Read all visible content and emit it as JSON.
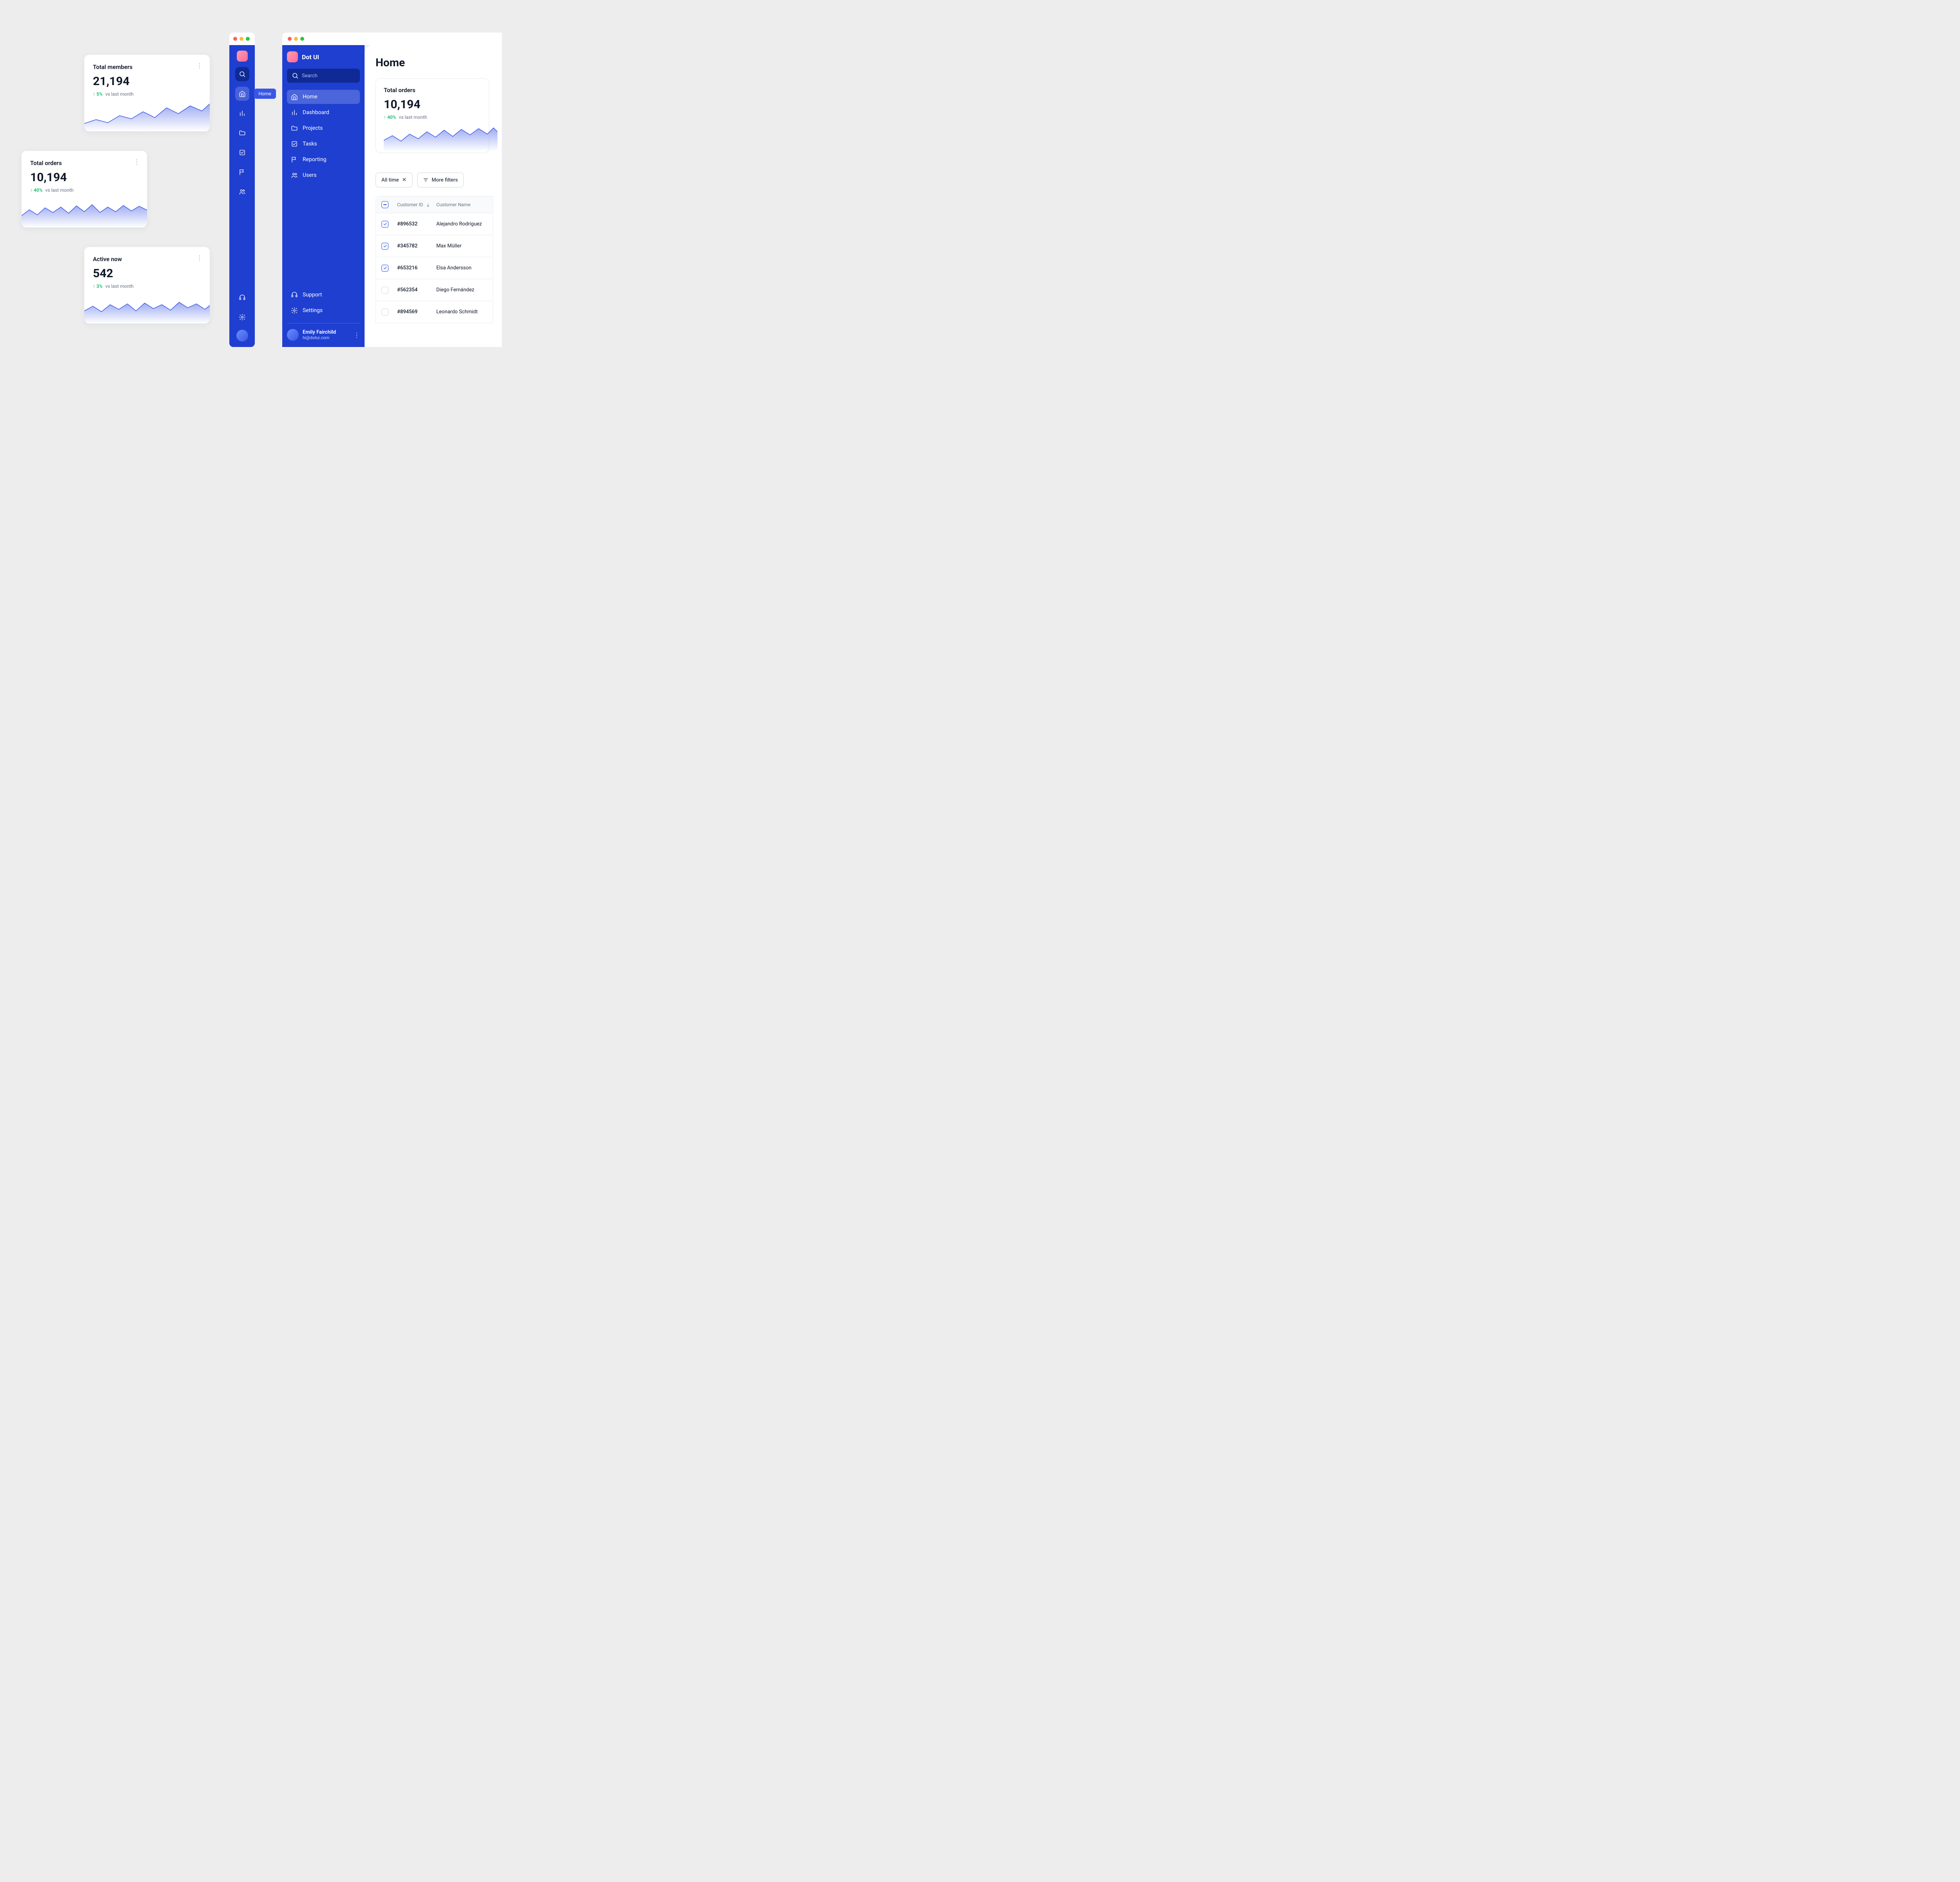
{
  "cards": {
    "members": {
      "title": "Total members",
      "value": "21,194",
      "pct": "5%",
      "vs": "vs last month"
    },
    "orders": {
      "title": "Total orders",
      "value": "10,194",
      "pct": "40%",
      "vs": "vs last month"
    },
    "active": {
      "title": "Active now",
      "value": "542",
      "pct": "3%",
      "vs": "vs last month"
    }
  },
  "mini": {
    "tooltip": "Home"
  },
  "app": {
    "brand": "Dot UI",
    "search_placeholder": "Search",
    "nav": [
      "Home",
      "Dashboard",
      "Projects",
      "Tasks",
      "Reporting",
      "Users"
    ],
    "bottom": [
      "Support",
      "Settings"
    ],
    "user": {
      "name": "Emily Fairchild",
      "email": "hi@dotui.com"
    }
  },
  "main": {
    "title": "Home",
    "card": {
      "title": "Total orders",
      "value": "10,194",
      "pct": "40%",
      "vs": "vs last month"
    },
    "filters": {
      "alltime": "All time",
      "more": "More filters"
    },
    "table": {
      "head": [
        "Customer ID",
        "Customer Name"
      ],
      "rows": [
        {
          "id": "#896532",
          "name": "Alejandro Rodríguez",
          "checked": true
        },
        {
          "id": "#345782",
          "name": "Max Müller",
          "checked": true
        },
        {
          "id": "#653216",
          "name": "Elsa Andersson",
          "checked": true
        },
        {
          "id": "#562354",
          "name": "Diego Fernández",
          "checked": false
        },
        {
          "id": "#894569",
          "name": "Leonardo Schmidt",
          "checked": false
        }
      ]
    }
  },
  "colors": {
    "brand": "#1f3fd1"
  },
  "chart_data": [
    {
      "type": "area",
      "title": "Total members",
      "values": [
        20,
        30,
        25,
        40,
        35,
        50,
        55,
        60,
        45,
        70,
        65,
        75
      ],
      "ylim": [
        0,
        100
      ]
    },
    {
      "type": "area",
      "title": "Total orders",
      "values": [
        35,
        45,
        30,
        50,
        40,
        55,
        38,
        60,
        48,
        62,
        42,
        58,
        46,
        64,
        50,
        66,
        52
      ],
      "ylim": [
        0,
        100
      ]
    },
    {
      "type": "area",
      "title": "Active now",
      "values": [
        40,
        50,
        35,
        55,
        42,
        58,
        38,
        60,
        44,
        56,
        40,
        62,
        46,
        58,
        42,
        54
      ],
      "ylim": [
        0,
        100
      ]
    },
    {
      "type": "area",
      "title": "Total orders (main)",
      "values": [
        30,
        42,
        28,
        46,
        34,
        52,
        38,
        56,
        42,
        60,
        48,
        64,
        50,
        66,
        54
      ],
      "ylim": [
        0,
        100
      ]
    }
  ]
}
